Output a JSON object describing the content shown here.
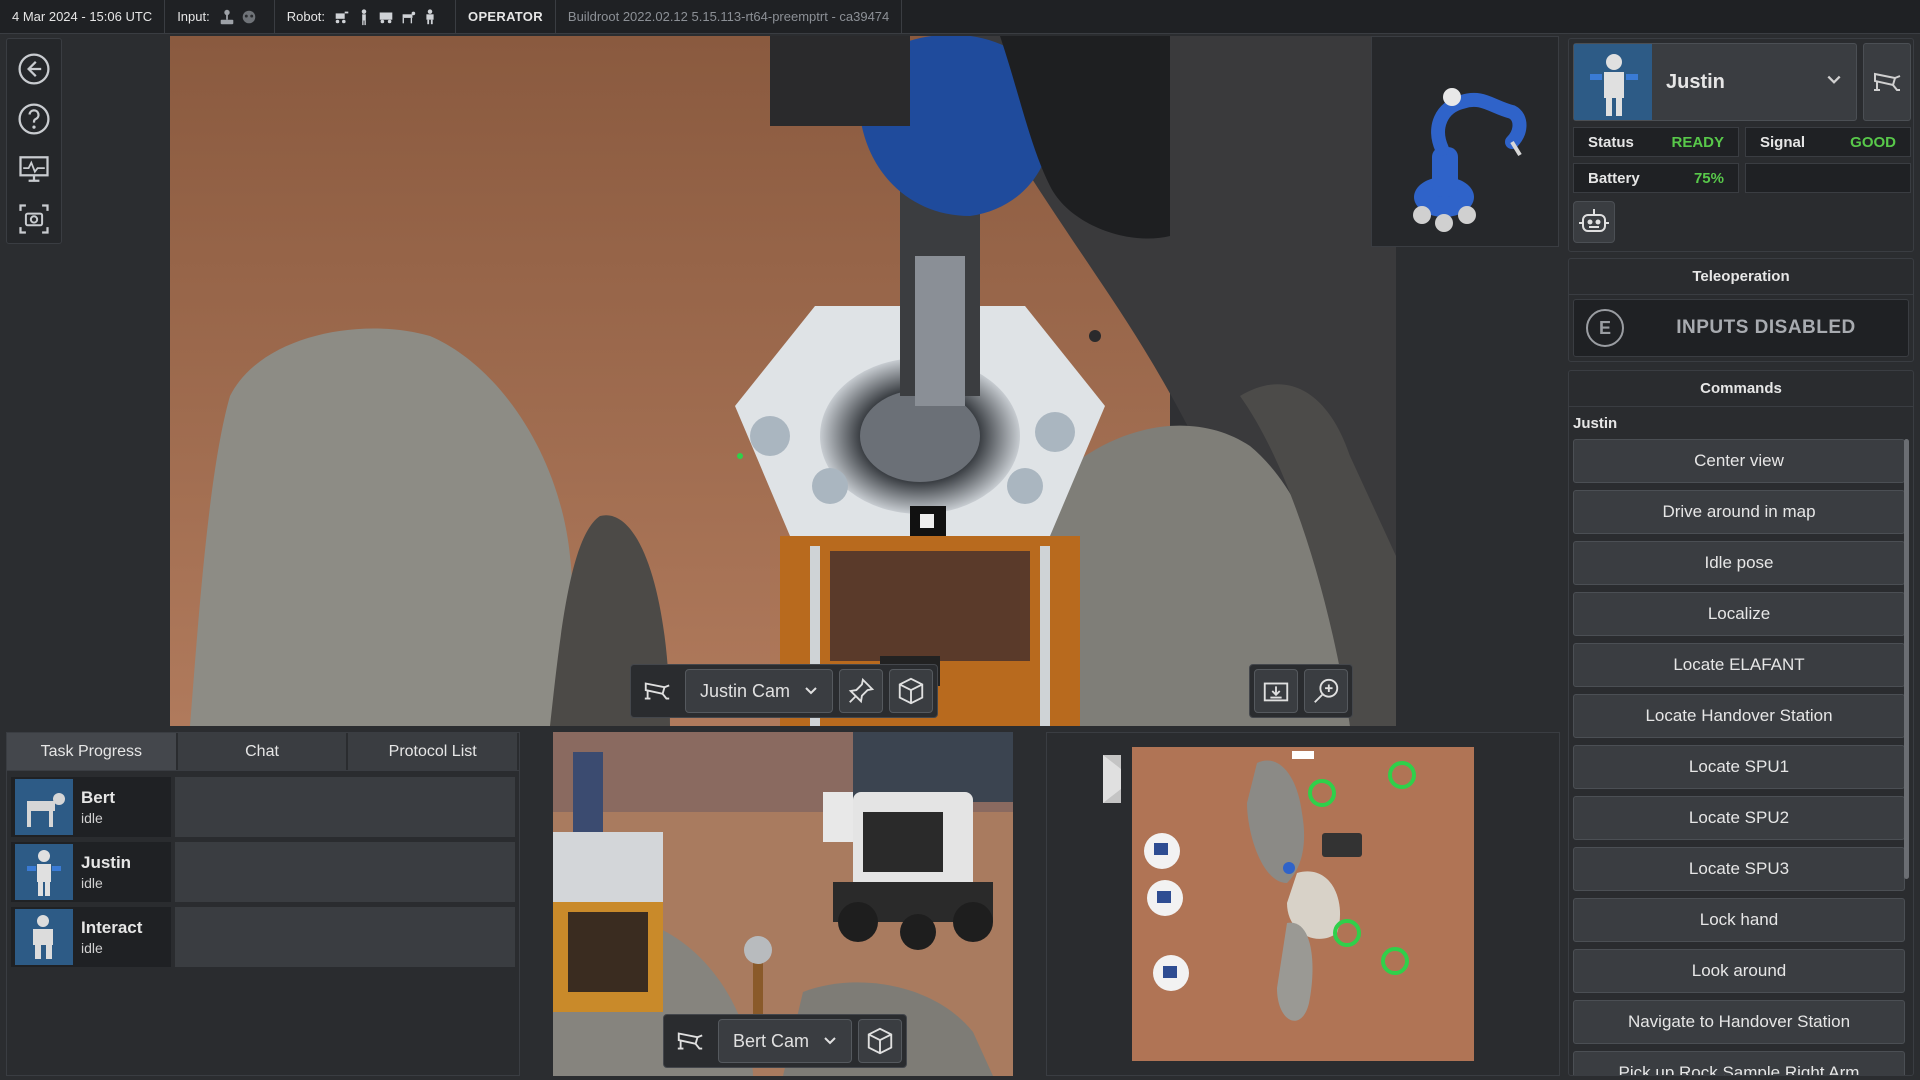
{
  "topbar": {
    "datetime": "4 Mar 2024 - 15:06 UTC",
    "input_label": "Input:",
    "robot_label": "Robot:",
    "role": "OPERATOR",
    "build": "Buildroot 2022.02.12 5.15.113-rt64-preemptrt - ca39474"
  },
  "lefttools": [
    "back-icon",
    "help-icon",
    "monitor-icon",
    "screenshot-icon"
  ],
  "main_camera": {
    "camera_select": "Justin Cam",
    "icons": [
      "camera-icon",
      "chevron-down-icon",
      "pin-icon",
      "cube-icon",
      "download-icon",
      "zoom-in-icon"
    ]
  },
  "robot": {
    "name": "Justin",
    "status_label": "Status",
    "status_value": "READY",
    "signal_label": "Signal",
    "signal_value": "GOOD",
    "battery_label": "Battery",
    "battery_value": "75%",
    "status_color": "#58c84a"
  },
  "teleoperation": {
    "title": "Teleoperation",
    "key": "E",
    "state": "INPUTS DISABLED"
  },
  "commands": {
    "title": "Commands",
    "owner": "Justin",
    "items": [
      "Center view",
      "Drive around in map",
      "Idle pose",
      "Localize",
      "Locate ELAFANT",
      "Locate Handover Station",
      "Locate SPU1",
      "Locate SPU2",
      "Locate SPU3",
      "Lock hand",
      "Look around",
      "Navigate to Handover Station",
      "Pick up Rock Sample Right Arm"
    ]
  },
  "tasks": {
    "tabs": [
      "Task Progress",
      "Chat",
      "Protocol List"
    ],
    "rows": [
      {
        "name": "Bert",
        "state": "idle"
      },
      {
        "name": "Justin",
        "state": "idle"
      },
      {
        "name": "Interact",
        "state": "idle"
      }
    ]
  },
  "bert_camera": {
    "camera_select": "Bert Cam"
  },
  "colors": {
    "accent_green": "#58c84a",
    "panel": "#2a2c2f",
    "robot_blue": "#2f63c9"
  }
}
